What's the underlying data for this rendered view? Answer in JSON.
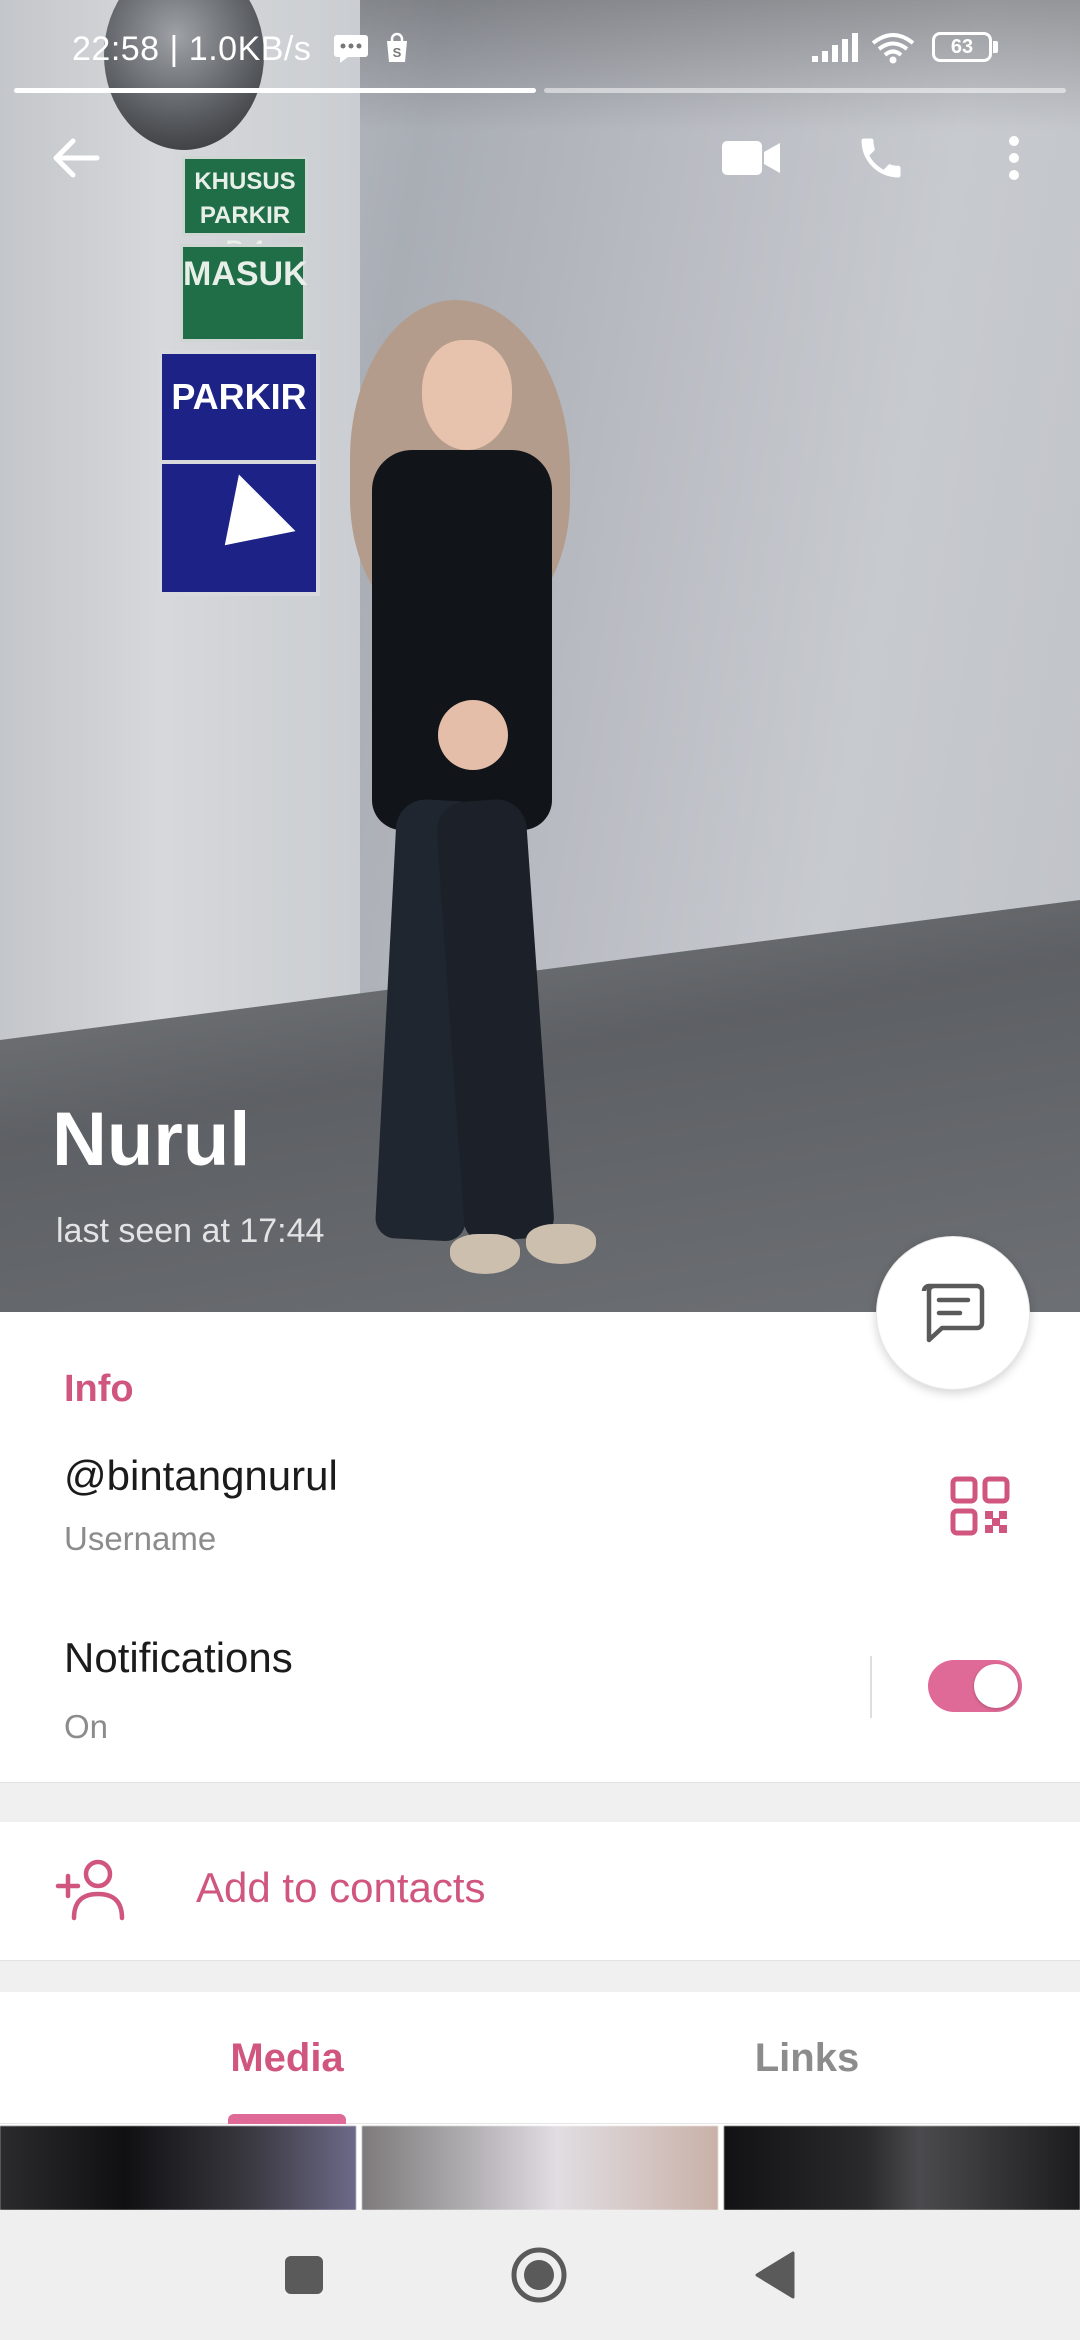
{
  "status_bar": {
    "time_and_speed": "22:58 | 1.0KB/s",
    "battery": "63",
    "story_progress": [
      1.0,
      0.0
    ]
  },
  "top_actions": {
    "back_icon": "arrow-back-icon",
    "video_icon": "video-call-icon",
    "call_icon": "phone-icon",
    "more_icon": "more-vert-icon"
  },
  "profile": {
    "name": "Nurul",
    "last_seen": "last seen at 17:44"
  },
  "photo_signs": {
    "sign1": "KHUSUS PARKIR R-4",
    "sign2": "MASUK",
    "sign3": "PARKIR"
  },
  "info": {
    "header": "Info",
    "username": "@bintangnurul",
    "username_label": "Username",
    "notifications_title": "Notifications",
    "notifications_value": "On",
    "notifications_enabled": true
  },
  "actions": {
    "add_contact": "Add to contacts"
  },
  "tabs": {
    "media": "Media",
    "links": "Links",
    "active": "media"
  },
  "colors": {
    "accent": "#d0567f",
    "toggle": "#e06a97",
    "secondary_text": "#8c8c8c"
  }
}
